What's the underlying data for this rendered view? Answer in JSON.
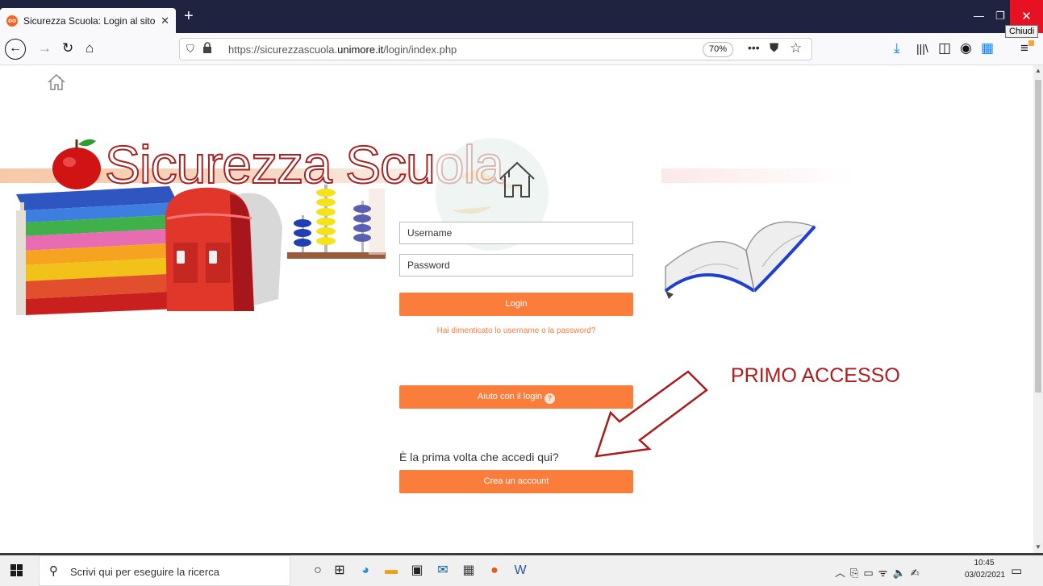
{
  "browser": {
    "tab_title": "Sicurezza Scuola: Login al sito",
    "tab_close": "✕",
    "new_tab": "+",
    "tooltip": "Chiudi",
    "url_prefix": "https://sicurezzascuola.",
    "url_domain": "unimore.it",
    "url_path": "/login/index.php",
    "zoom": "70%",
    "url_more": "•••"
  },
  "banner": {
    "title_main": "Sicurezza Scu",
    "title_fade": "ola"
  },
  "login": {
    "username_placeholder": "Username",
    "password_placeholder": "Password",
    "login_label": "Login",
    "forgot_label": "Hai dimenticato lo username o la password?",
    "help_label": "Aiuto con il login",
    "help_badge": "?",
    "first_time_text": "È la prima volta che accedi qui?",
    "create_account_label": "Crea un account"
  },
  "annotation": {
    "text": "PRIMO ACCESSO",
    "color": "#b01c1c"
  },
  "taskbar": {
    "search_placeholder": "Scrivi qui per eseguire la ricerca",
    "time": "10:45",
    "date": "03/02/2021"
  },
  "colors": {
    "accent_orange": "#fb7d3c",
    "titlebar": "#202340",
    "close_red": "#e81123"
  }
}
